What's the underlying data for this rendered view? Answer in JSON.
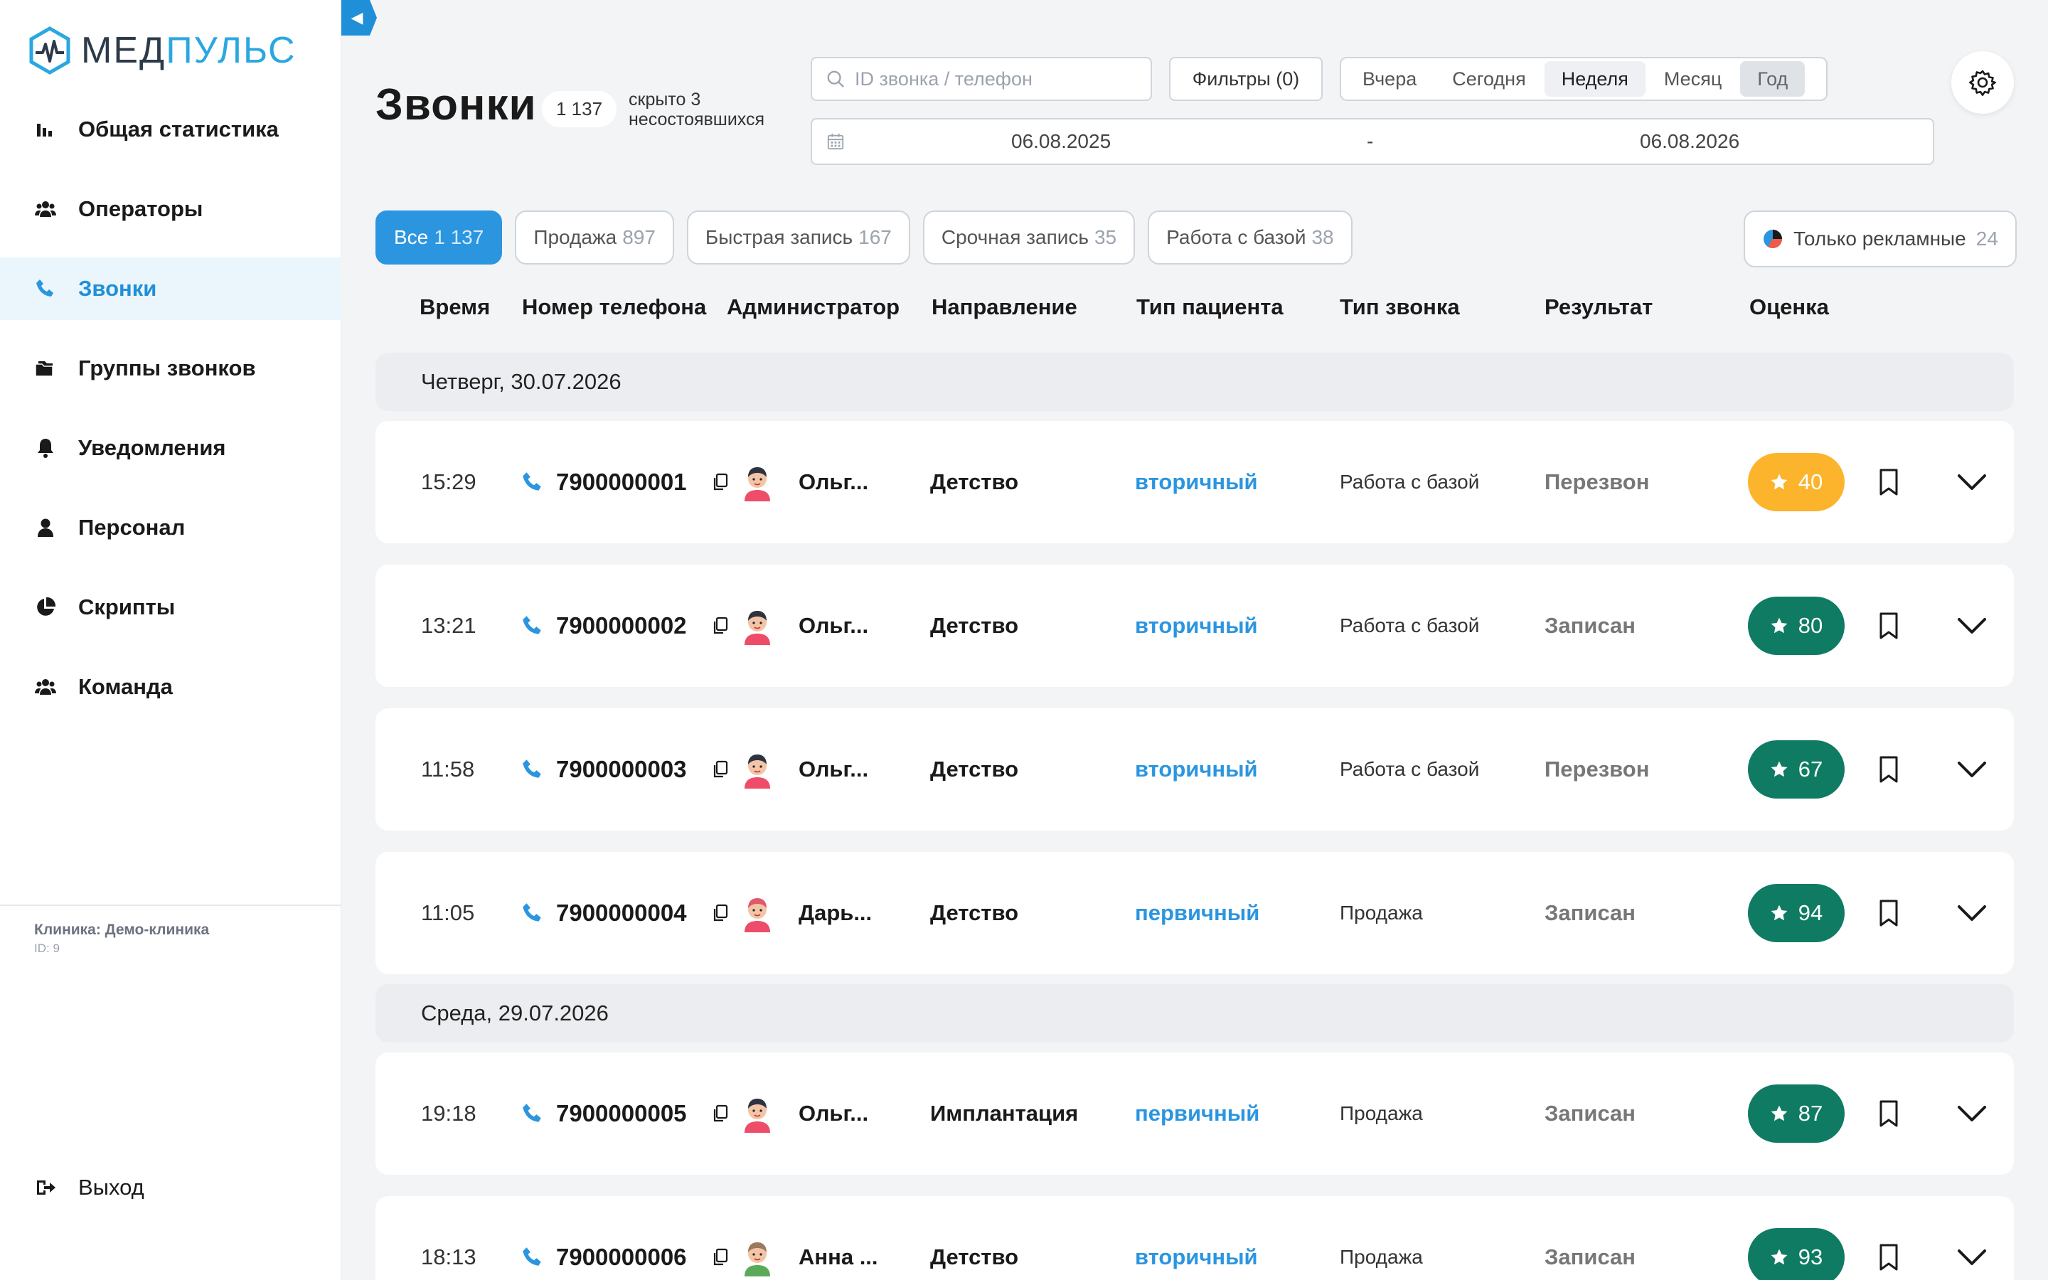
{
  "app": {
    "brand_part1": "МЕД",
    "brand_part2": "ПУЛЬС"
  },
  "colors": {
    "accent": "#2b95e0",
    "score_high": "#0f7b63",
    "score_mid": "#fbb42c"
  },
  "sidebar": {
    "items": [
      {
        "label": "Общая статистика",
        "icon": "bar-chart-icon"
      },
      {
        "label": "Операторы",
        "icon": "users-icon"
      },
      {
        "label": "Звонки",
        "icon": "phone-icon"
      },
      {
        "label": "Группы звонков",
        "icon": "folder-icon"
      },
      {
        "label": "Уведомления",
        "icon": "bell-icon"
      },
      {
        "label": "Персонал",
        "icon": "person-icon"
      },
      {
        "label": "Скрипты",
        "icon": "pie-icon"
      },
      {
        "label": "Команда",
        "icon": "users-icon"
      }
    ],
    "active_index": 2,
    "clinic_label": "Клиника: Демо-клиника",
    "clinic_id": "ID: 9",
    "logout_label": "Выход"
  },
  "header": {
    "title": "Звонки",
    "total": "1 137",
    "hidden_note": "скрыто 3 несостоявшихся",
    "search_placeholder": "ID звонка / телефон",
    "filters_label": "Фильтры (0)",
    "periods": [
      "Вчера",
      "Сегодня",
      "Неделя",
      "Месяц",
      "Год"
    ],
    "period_active": "Год",
    "date_from": "06.08.2025",
    "date_separator": "-",
    "date_to": "06.08.2026"
  },
  "categories": [
    {
      "label": "Все",
      "count": "1 137",
      "active": true
    },
    {
      "label": "Продажа",
      "count": "897"
    },
    {
      "label": "Быстрая запись",
      "count": "167"
    },
    {
      "label": "Срочная запись",
      "count": "35"
    },
    {
      "label": "Работа с базой",
      "count": "38"
    }
  ],
  "ads_filter": {
    "label": "Только рекламные",
    "count": "24"
  },
  "columns": [
    "Время",
    "Номер телефона",
    "Администратор",
    "Направление",
    "Тип пациента",
    "Тип звонка",
    "Результат",
    "Оценка"
  ],
  "days": [
    {
      "label": "Четверг, 30.07.2026",
      "calls": [
        {
          "time": "15:29",
          "phone": "7900000001",
          "admin": "Ольг...",
          "direction": "Детство",
          "patient_type": "вторичный",
          "call_type": "Работа с базой",
          "result": "Перезвон",
          "score": "40",
          "avatar": "female"
        },
        {
          "time": "13:21",
          "phone": "7900000002",
          "admin": "Ольг...",
          "direction": "Детство",
          "patient_type": "вторичный",
          "call_type": "Работа с базой",
          "result": "Записан",
          "score": "80",
          "avatar": "female"
        },
        {
          "time": "11:58",
          "phone": "7900000003",
          "admin": "Ольг...",
          "direction": "Детство",
          "patient_type": "вторичный",
          "call_type": "Работа с базой",
          "result": "Перезвон",
          "score": "67",
          "avatar": "female"
        },
        {
          "time": "11:05",
          "phone": "7900000004",
          "admin": "Дарь...",
          "direction": "Детство",
          "patient_type": "первичный",
          "call_type": "Продажа",
          "result": "Записан",
          "score": "94",
          "avatar": "female2"
        }
      ]
    },
    {
      "label": "Среда, 29.07.2026",
      "calls": [
        {
          "time": "19:18",
          "phone": "7900000005",
          "admin": "Ольг...",
          "direction": "Имплантация",
          "patient_type": "первичный",
          "call_type": "Продажа",
          "result": "Записан",
          "score": "87",
          "avatar": "female"
        },
        {
          "time": "18:13",
          "phone": "7900000006",
          "admin": "Анна ...",
          "direction": "Детство",
          "patient_type": "вторичный",
          "call_type": "Продажа",
          "result": "Записан",
          "score": "93",
          "avatar": "female3"
        }
      ]
    }
  ]
}
